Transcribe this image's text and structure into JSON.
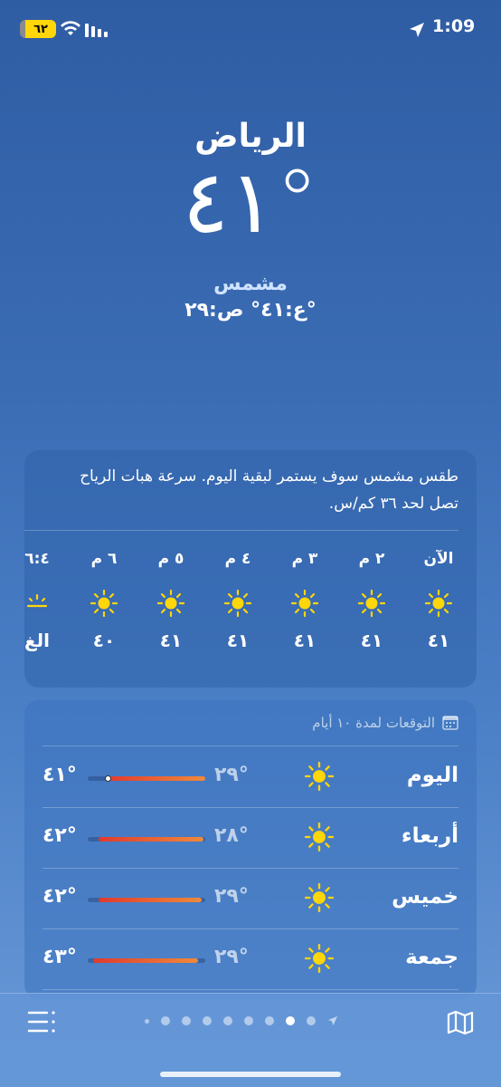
{
  "status_bar": {
    "battery": "٦٢",
    "time": "1:09"
  },
  "header": {
    "city": "الرياض",
    "temperature": "٤١°",
    "condition": "مشمس",
    "high_low": "ع:٤١° ص:٢٩°"
  },
  "hourly": {
    "summary": "طقس مشمس سوف يستمر لبقية اليوم. سرعة هبات الرياح تصل لحد ٣٦ كم/س.",
    "hours": [
      {
        "label": "الآن",
        "temp": "٤١",
        "icon": "sun-icon"
      },
      {
        "label": "٢ م",
        "temp": "٤١",
        "icon": "sun-icon"
      },
      {
        "label": "٣ م",
        "temp": "٤١",
        "icon": "sun-icon"
      },
      {
        "label": "٤ م",
        "temp": "٤١",
        "icon": "sun-icon"
      },
      {
        "label": "٥ م",
        "temp": "٤١",
        "icon": "sun-icon"
      },
      {
        "label": "٦ م",
        "temp": "٤٠",
        "icon": "sun-icon"
      },
      {
        "label": "٦:٤",
        "temp": "الغ",
        "icon": "sunset-icon"
      }
    ]
  },
  "daily": {
    "title": "التوقعات لمدة ١٠ أيام",
    "days": [
      {
        "name": "اليوم",
        "low": "٢٩°",
        "high": "٤١°",
        "icon": "sun-icon"
      },
      {
        "name": "أربعاء",
        "low": "٢٨°",
        "high": "٤٢°",
        "icon": "sun-icon"
      },
      {
        "name": "خميس",
        "low": "٢٩°",
        "high": "٤٢°",
        "icon": "sun-icon"
      },
      {
        "name": "جمعة",
        "low": "٢٩°",
        "high": "٤٣°",
        "icon": "sun-icon"
      }
    ]
  },
  "colors": {
    "accent_temp_bar_start": "#e03a2e",
    "accent_temp_bar_end": "#f08a3a",
    "sun": "#ffd60a",
    "battery": "#ffd60a"
  }
}
